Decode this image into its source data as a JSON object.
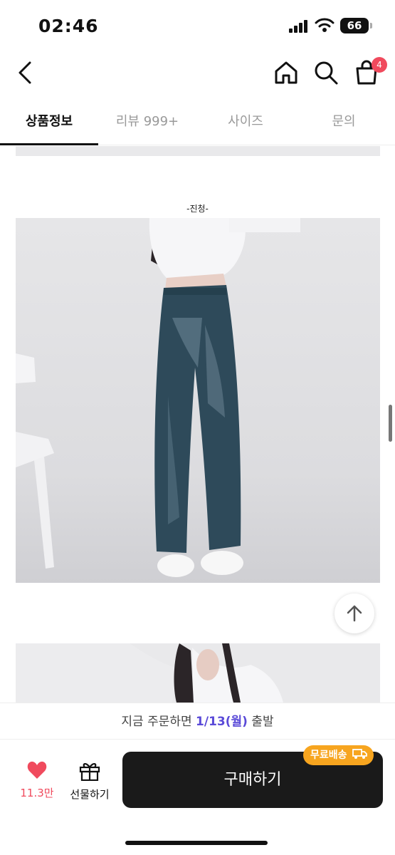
{
  "status_bar": {
    "time": "02:46",
    "battery": "66"
  },
  "nav": {
    "cart_count": "4"
  },
  "tabs": [
    {
      "label": "상품정보",
      "active": true
    },
    {
      "label": "리뷰 999+",
      "active": false
    },
    {
      "label": "사이즈",
      "active": false
    },
    {
      "label": "문의",
      "active": false
    }
  ],
  "content": {
    "caption": "-진청-"
  },
  "bottom": {
    "ship_prefix": "지금 주문하면",
    "ship_date": "1/13(월)",
    "ship_suffix": "출발",
    "like_count": "11.3만",
    "gift_label": "선물하기",
    "buy_label": "구매하기",
    "free_shipping": "무료배송"
  },
  "colors": {
    "accent_like": "#f04a5d",
    "ship_date": "#5a4ad8",
    "free_badge": "#f7a51f",
    "buy_button": "#1a1a1a"
  }
}
